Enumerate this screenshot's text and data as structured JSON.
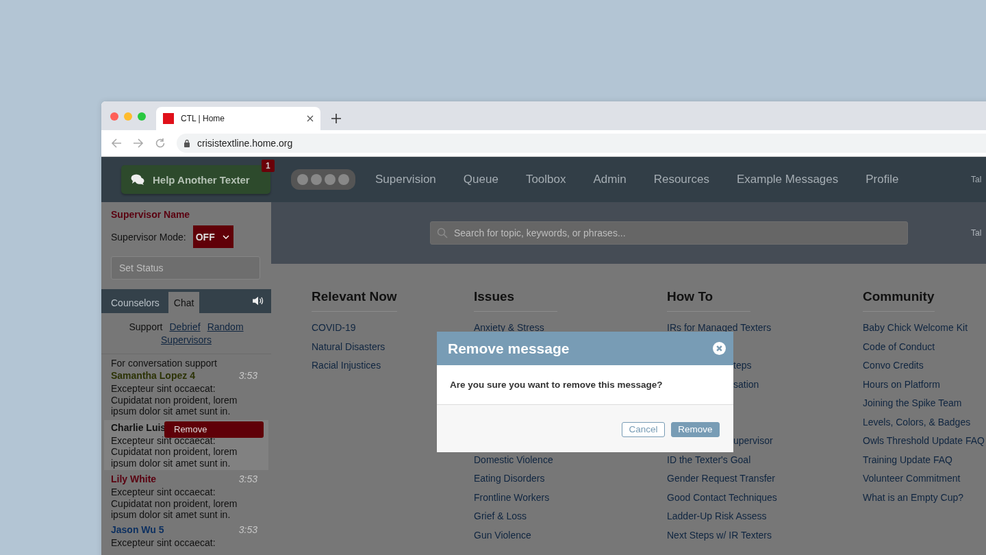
{
  "browser": {
    "tab_title": "CTL | Home",
    "url": "crisistextline.home.org"
  },
  "nav": {
    "help_button": "Help Another Texter",
    "help_badge": "1",
    "items": [
      "Supervision",
      "Queue",
      "Toolbox",
      "Admin",
      "Resources",
      "Example Messages",
      "Profile"
    ],
    "edge_text": "Tal"
  },
  "sidebar": {
    "supervisor_name": "Supervisor Name",
    "mode_label": "Supervisor Mode:",
    "mode_value": "OFF",
    "status_placeholder": "Set Status",
    "tabs": [
      {
        "label": "Counselors",
        "selected": false
      },
      {
        "label": "Chat",
        "selected": true
      }
    ],
    "channels": [
      {
        "label": "Support",
        "selected": true
      },
      {
        "label": "Debrief",
        "selected": false
      },
      {
        "label": "Random",
        "selected": false
      },
      {
        "label": "Supervisors",
        "selected": false
      }
    ],
    "messages": [
      {
        "preface": "For conversation support",
        "name": "Samantha Lopez 4",
        "color": "#2c3306",
        "time": "3:53",
        "body": "Excepteur sint occaecat: Cupidatat non proident, lorem ipsum dolor sit amet sunt in.",
        "highlighted": false
      },
      {
        "name": "Charlie Luis",
        "color": "#111111",
        "action": "Remove",
        "body": "Excepteur sint occaecat: Cupidatat non proident, lorem ipsum dolor sit amet sunt in.",
        "highlighted": true
      },
      {
        "name": "Lily White",
        "color": "#5a0010",
        "time": "3:53",
        "body": "Excepteur sint occaecat: Cupidatat non proident, lorem ipsum dolor sit amet sunt in.",
        "highlighted": false
      },
      {
        "name": "Jason Wu 5",
        "color": "#0d3060",
        "time": "3:53",
        "body": "Excepteur sint occaecat:",
        "highlighted": false
      }
    ]
  },
  "search": {
    "placeholder": "Search for topic, keywords, or phrases...",
    "edge_text": "Tal"
  },
  "columns": [
    {
      "heading": "Relevant Now",
      "items": [
        {
          "label": "COVID-19",
          "kind": "link"
        },
        {
          "label": "Natural Disasters",
          "kind": "link"
        },
        {
          "label": "Racial Injustices",
          "kind": "link"
        }
      ]
    },
    {
      "heading": "Issues",
      "items": [
        {
          "label": "Anxiety & Stress",
          "kind": "link"
        },
        {
          "label": "Domestic Violence",
          "kind": "link"
        },
        {
          "label": "Eating Disorders",
          "kind": "link"
        },
        {
          "label": "Frontline Workers",
          "kind": "link"
        },
        {
          "label": "Grief & Loss",
          "kind": "link"
        },
        {
          "label": "Gun Violence",
          "kind": "link"
        }
      ]
    },
    {
      "heading": "How To",
      "items": [
        {
          "label": "IRs for Managed Texters",
          "kind": "link"
        },
        {
          "label": "teps",
          "kind": "clipped"
        },
        {
          "label": "sation",
          "kind": "clipped"
        },
        {
          "label": "upervisor",
          "kind": "clipped"
        },
        {
          "label": "ID the Texter's Goal",
          "kind": "link"
        },
        {
          "label": "Gender Request Transfer",
          "kind": "link"
        },
        {
          "label": "Good Contact Techniques",
          "kind": "link"
        },
        {
          "label": "Ladder-Up Risk Assess",
          "kind": "link"
        },
        {
          "label": "Next Steps w/ IR Texters",
          "kind": "link"
        }
      ]
    },
    {
      "heading": "Community",
      "items": [
        {
          "label": "Baby Chick Welcome Kit",
          "kind": "link"
        },
        {
          "label": "Code of Conduct",
          "kind": "link"
        },
        {
          "label": "Convo Credits",
          "kind": "link"
        },
        {
          "label": "Hours on Platform",
          "kind": "link"
        },
        {
          "label": "Joining the Spike Team",
          "kind": "link"
        },
        {
          "label": "Levels, Colors, & Badges",
          "kind": "link"
        },
        {
          "label": "Owls Threshold Update FAQ",
          "kind": "link"
        },
        {
          "label": "Training Update FAQ",
          "kind": "link"
        },
        {
          "label": "Volunteer Commitment",
          "kind": "link"
        },
        {
          "label": "What is an Empty Cup?",
          "kind": "link"
        }
      ]
    }
  ],
  "modal": {
    "title": "Remove message",
    "text": "Are you sure you want to remove this message?",
    "buttons": [
      {
        "label": "Cancel",
        "kind": "secondary"
      },
      {
        "label": "Remove",
        "kind": "primary"
      }
    ]
  }
}
